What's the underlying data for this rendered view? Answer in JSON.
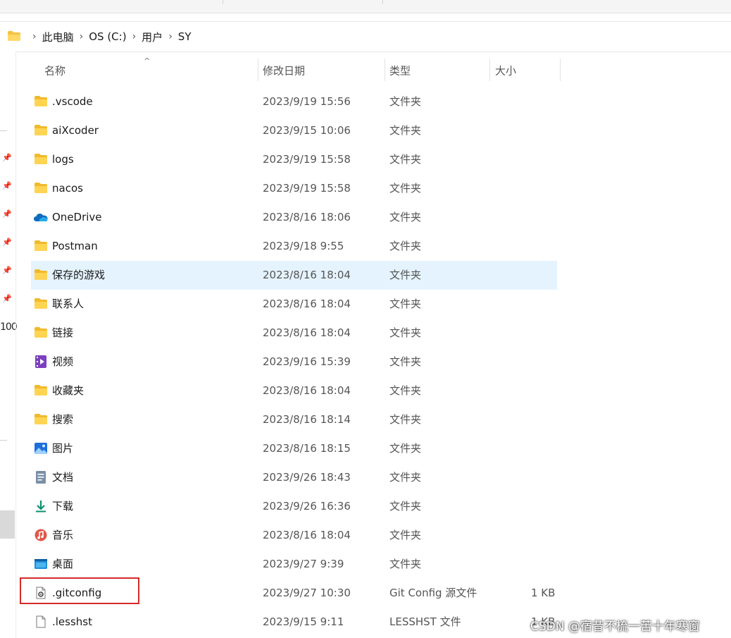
{
  "breadcrumb": [
    {
      "label": "此电脑"
    },
    {
      "label": "OS (C:)"
    },
    {
      "label": "用户"
    },
    {
      "label": "SY"
    }
  ],
  "nav_cut_text": "100",
  "columns": {
    "name": "名称",
    "date": "修改日期",
    "type": "类型",
    "size": "大小"
  },
  "files": [
    {
      "name": ".vscode",
      "date": "2023/9/19 15:56",
      "type": "文件夹",
      "size": "",
      "icon": "folder-icon"
    },
    {
      "name": "aiXcoder",
      "date": "2023/9/15 10:06",
      "type": "文件夹",
      "size": "",
      "icon": "folder-icon"
    },
    {
      "name": "logs",
      "date": "2023/9/19 15:58",
      "type": "文件夹",
      "size": "",
      "icon": "folder-icon"
    },
    {
      "name": "nacos",
      "date": "2023/9/19 15:58",
      "type": "文件夹",
      "size": "",
      "icon": "folder-icon"
    },
    {
      "name": "OneDrive",
      "date": "2023/8/16 18:06",
      "type": "文件夹",
      "size": "",
      "icon": "onedrive-cloud-icon"
    },
    {
      "name": "Postman",
      "date": "2023/9/18 9:55",
      "type": "文件夹",
      "size": "",
      "icon": "folder-icon"
    },
    {
      "name": "保存的游戏",
      "date": "2023/8/16 18:04",
      "type": "文件夹",
      "size": "",
      "icon": "folder-icon",
      "selected": true
    },
    {
      "name": "联系人",
      "date": "2023/8/16 18:04",
      "type": "文件夹",
      "size": "",
      "icon": "folder-icon"
    },
    {
      "name": "链接",
      "date": "2023/8/16 18:04",
      "type": "文件夹",
      "size": "",
      "icon": "folder-icon"
    },
    {
      "name": "视频",
      "date": "2023/9/16 15:39",
      "type": "文件夹",
      "size": "",
      "icon": "video-folder-icon"
    },
    {
      "name": "收藏夹",
      "date": "2023/8/16 18:04",
      "type": "文件夹",
      "size": "",
      "icon": "folder-icon"
    },
    {
      "name": "搜索",
      "date": "2023/8/16 18:14",
      "type": "文件夹",
      "size": "",
      "icon": "folder-icon"
    },
    {
      "name": "图片",
      "date": "2023/8/16 18:15",
      "type": "文件夹",
      "size": "",
      "icon": "pictures-folder-icon"
    },
    {
      "name": "文档",
      "date": "2023/9/26 18:43",
      "type": "文件夹",
      "size": "",
      "icon": "documents-folder-icon"
    },
    {
      "name": "下载",
      "date": "2023/9/26 16:36",
      "type": "文件夹",
      "size": "",
      "icon": "downloads-arrow-icon"
    },
    {
      "name": "音乐",
      "date": "2023/8/16 18:04",
      "type": "文件夹",
      "size": "",
      "icon": "music-folder-icon"
    },
    {
      "name": "桌面",
      "date": "2023/9/27 9:39",
      "type": "文件夹",
      "size": "",
      "icon": "desktop-folder-icon"
    },
    {
      "name": ".gitconfig",
      "date": "2023/9/27 10:30",
      "type": "Git Config 源文件",
      "size": "1 KB",
      "icon": "config-file-icon"
    },
    {
      "name": ".lesshst",
      "date": "2023/9/15 9:11",
      "type": "LESSHST 文件",
      "size": "1 KB",
      "icon": "blank-file-icon"
    }
  ],
  "annotation_color": "#d62a2a",
  "selection_color": "#e5f3ff",
  "watermark": "CSDN @宿昔不梳一苦十年寒窗"
}
